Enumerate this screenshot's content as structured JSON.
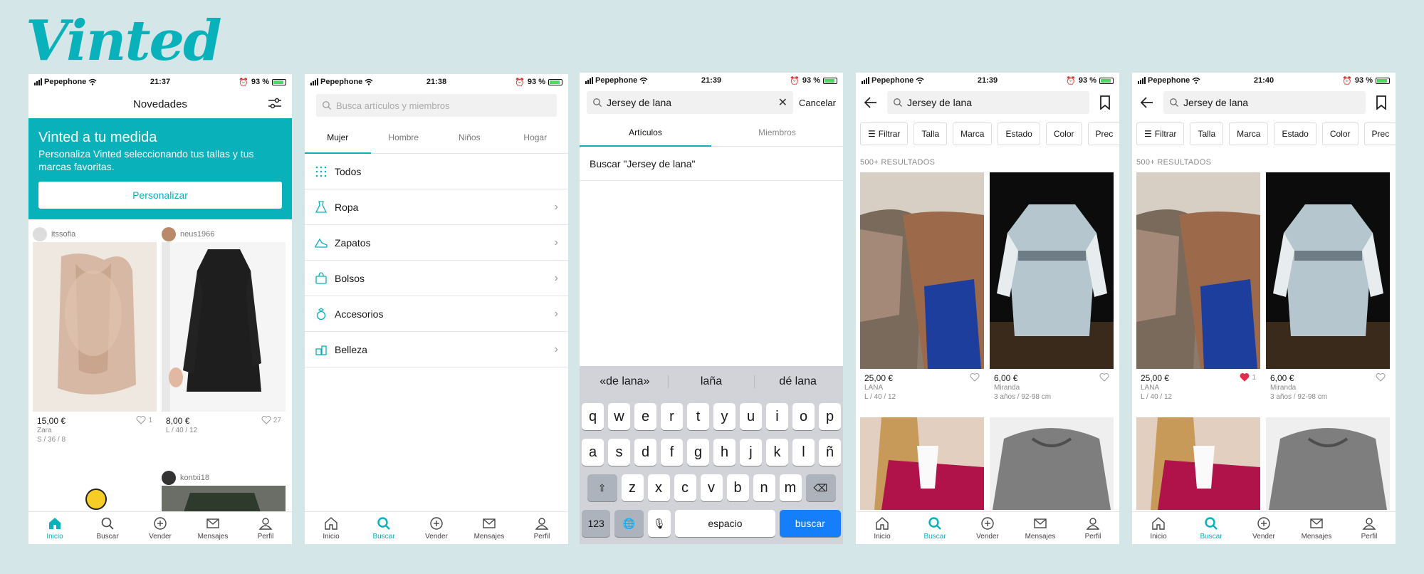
{
  "logo": "Vinted",
  "colors": {
    "accent": "#09b1ba",
    "like_active": "#e52e4d",
    "keyboard_go": "#147efb"
  },
  "screens": [
    {
      "status": {
        "carrier": "Pepephone",
        "time": "21:37",
        "battery": "93 %"
      },
      "header": {
        "title": "Novedades",
        "filter_icon": "sliders-icon"
      },
      "banner": {
        "title": "Vinted a tu medida",
        "text": "Personaliza Vinted seleccionando tus tallas y tus marcas favoritas.",
        "button": "Personalizar"
      },
      "items": [
        {
          "user": "itssofia",
          "price": "15,00 €",
          "brand": "Zara",
          "size": "S / 36 / 8",
          "likes": "1"
        },
        {
          "user": "neus1966",
          "price": "8,00 €",
          "brand": "",
          "size": "L / 40 / 12",
          "likes": "27"
        },
        {
          "user": "kontxi18"
        }
      ],
      "tabbar": [
        {
          "label": "Inicio",
          "icon": "home-icon"
        },
        {
          "label": "Buscar",
          "icon": "search-icon"
        },
        {
          "label": "Vender",
          "icon": "plus-circle-icon"
        },
        {
          "label": "Mensajes",
          "icon": "mail-icon"
        },
        {
          "label": "Perfil",
          "icon": "user-icon"
        }
      ]
    },
    {
      "status": {
        "carrier": "Pepephone",
        "time": "21:38",
        "battery": "93 %"
      },
      "search": {
        "placeholder": "Busca artículos y miembros"
      },
      "tabs": [
        "Mujer",
        "Hombre",
        "Niños",
        "Hogar"
      ],
      "categories": [
        {
          "label": "Todos",
          "icon": "grid-icon"
        },
        {
          "label": "Ropa",
          "icon": "dress-icon"
        },
        {
          "label": "Zapatos",
          "icon": "shoe-icon"
        },
        {
          "label": "Bolsos",
          "icon": "bag-icon"
        },
        {
          "label": "Accesorios",
          "icon": "ring-icon"
        },
        {
          "label": "Belleza",
          "icon": "cosmetics-icon"
        }
      ]
    },
    {
      "status": {
        "carrier": "Pepephone",
        "time": "21:39",
        "battery": "93 %"
      },
      "search": {
        "value": "Jersey de lana",
        "cancel": "Cancelar"
      },
      "tabs": [
        "Artículos",
        "Miembros"
      ],
      "suggestion": "Buscar \"Jersey de lana\"",
      "keyboard": {
        "suggestions": [
          "«de lana»",
          "laña",
          "dé lana"
        ],
        "row1": [
          "q",
          "w",
          "e",
          "r",
          "t",
          "y",
          "u",
          "i",
          "o",
          "p"
        ],
        "row2": [
          "a",
          "s",
          "d",
          "f",
          "g",
          "h",
          "j",
          "k",
          "l",
          "ñ"
        ],
        "row3": [
          "z",
          "x",
          "c",
          "v",
          "b",
          "n",
          "m"
        ],
        "num": "123",
        "space": "espacio",
        "go": "buscar"
      }
    },
    {
      "status": {
        "carrier": "Pepephone",
        "time": "21:39",
        "battery": "93 %"
      },
      "search": {
        "value": "Jersey de lana"
      },
      "chips": [
        "Filtrar",
        "Talla",
        "Marca",
        "Estado",
        "Color",
        "Prec"
      ],
      "results": "500+ RESULTADOS",
      "items": [
        {
          "price": "25,00 €",
          "brand": "LANA",
          "size": "L / 40 / 12",
          "likes": "",
          "liked": false
        },
        {
          "price": "6,00 €",
          "brand": "Miranda",
          "size": "3 años / 92-98 cm",
          "likes": "",
          "liked": false
        }
      ]
    },
    {
      "status": {
        "carrier": "Pepephone",
        "time": "21:40",
        "battery": "93 %"
      },
      "search": {
        "value": "Jersey de lana"
      },
      "chips": [
        "Filtrar",
        "Talla",
        "Marca",
        "Estado",
        "Color",
        "Prec"
      ],
      "results": "500+ RESULTADOS",
      "items": [
        {
          "price": "25,00 €",
          "brand": "LANA",
          "size": "L / 40 / 12",
          "likes": "1",
          "liked": true
        },
        {
          "price": "6,00 €",
          "brand": "Miranda",
          "size": "3 años / 92-98 cm",
          "likes": "",
          "liked": false
        }
      ]
    }
  ]
}
